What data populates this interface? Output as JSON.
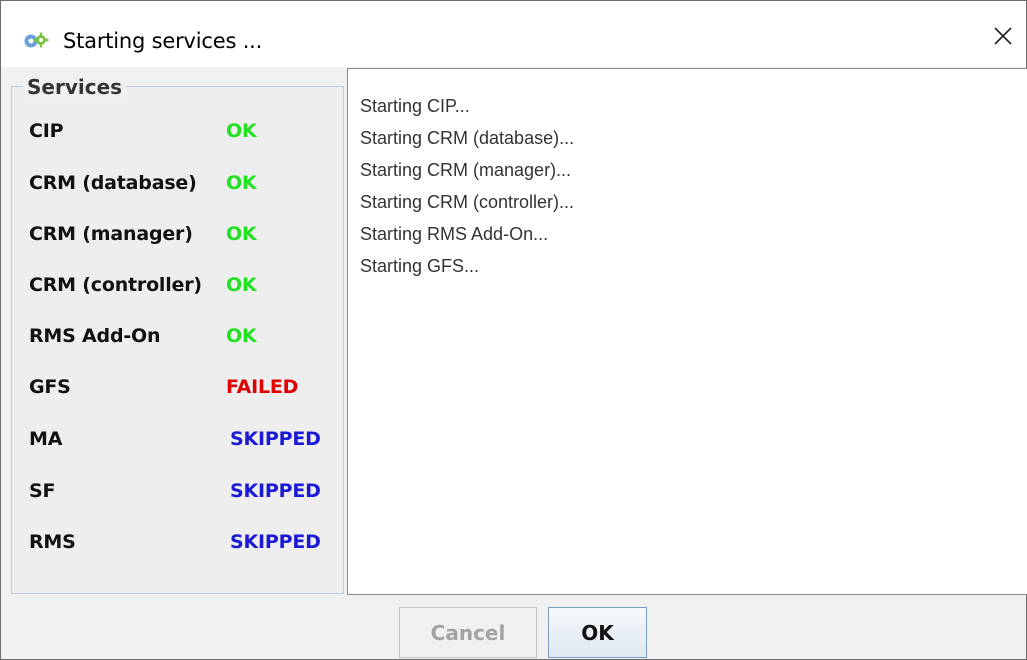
{
  "window": {
    "title": "Starting services ...",
    "close_glyph": "✕"
  },
  "services": {
    "legend": "Services",
    "items": [
      {
        "name": "CIP",
        "status": "OK",
        "color": "#22e022"
      },
      {
        "name": "CRM (database)",
        "status": "OK",
        "color": "#22e022"
      },
      {
        "name": "CRM (manager)",
        "status": "OK",
        "color": "#22e022"
      },
      {
        "name": "CRM (controller)",
        "status": "OK",
        "color": "#22e022"
      },
      {
        "name": "RMS Add-On",
        "status": "OK",
        "color": "#22e022"
      },
      {
        "name": "GFS",
        "status": "FAILED",
        "color": "#e00000"
      },
      {
        "name": "MA",
        "status": "SKIPPED",
        "color": "#1a1ad6"
      },
      {
        "name": "SF",
        "status": "SKIPPED",
        "color": "#1a1ad6"
      },
      {
        "name": "RMS",
        "status": "SKIPPED",
        "color": "#1a1ad6"
      }
    ]
  },
  "log": {
    "lines": [
      "Starting CIP...",
      "Starting CRM (database)...",
      "Starting CRM (manager)...",
      "Starting CRM (controller)...",
      "Starting RMS Add-On...",
      "Starting GFS..."
    ]
  },
  "buttons": {
    "cancel_label": "Cancel",
    "cancel_enabled": false,
    "ok_label": "OK"
  }
}
